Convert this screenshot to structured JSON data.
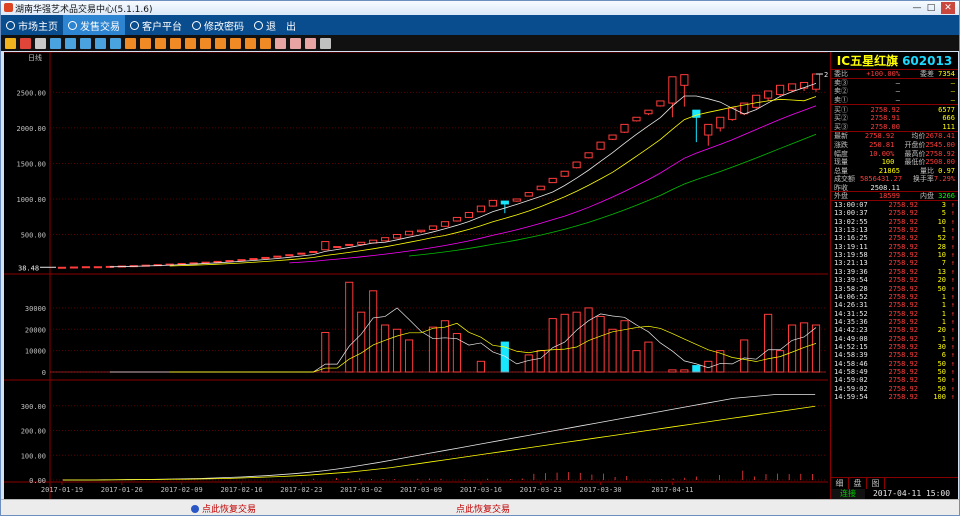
{
  "window": {
    "title": "湖南华强艺术品交易中心(5.1.1.6)",
    "min": "—",
    "max": "□",
    "close": "✕"
  },
  "menu": [
    {
      "label": "市场主页",
      "icon": "globe-icon",
      "active": false
    },
    {
      "label": "发售交易",
      "icon": "chart-icon",
      "active": true
    },
    {
      "label": "客户平台",
      "icon": "user-icon",
      "active": false
    },
    {
      "label": "修改密码",
      "icon": "key-icon",
      "active": false
    },
    {
      "label": "退",
      "icon": "power-icon",
      "active": false
    },
    {
      "label": "出",
      "icon": "",
      "active": false
    }
  ],
  "toolbar_colors": [
    "#f2b21e",
    "#e0453a",
    "#c9c9c9",
    "#4aa3df",
    "#4aa3df",
    "#4aa3df",
    "#4aa3df",
    "#4aa3df",
    "#f08a24",
    "#f08a24",
    "#f08a24",
    "#f08a24",
    "#f08a24",
    "#f08a24",
    "#f08a24",
    "#f08a24",
    "#f08a24",
    "#f08a24",
    "#e8a3a3",
    "#e8a3a3",
    "#e8a3a3",
    "#c0c0c0"
  ],
  "stock": {
    "name": "IC五星红旗",
    "code": "602013"
  },
  "quote": {
    "weibi_label": "委比",
    "weibi": "+100.00%",
    "weicha_label": "委差",
    "weicha": "7354",
    "sell": [
      {
        "label": "卖③",
        "price": "—",
        "vol": "—"
      },
      {
        "label": "卖②",
        "price": "—",
        "vol": "—"
      },
      {
        "label": "卖①",
        "price": "—",
        "vol": "—"
      }
    ],
    "buy": [
      {
        "label": "买①",
        "price": "2758.92",
        "vol": "6577"
      },
      {
        "label": "买②",
        "price": "2758.91",
        "vol": "666"
      },
      {
        "label": "买③",
        "price": "2758.00",
        "vol": "111"
      }
    ],
    "stats": [
      {
        "l1": "最新",
        "v1": "2758.92",
        "l2": "均价",
        "v2": "2678.41"
      },
      {
        "l1": "涨跌",
        "v1": "250.81",
        "l2": "开盘价",
        "v2": "2545.00"
      },
      {
        "l1": "幅度",
        "v1": "10.00%",
        "l2": "最高价",
        "v2": "2758.92"
      },
      {
        "l1": "现量",
        "v1": "100",
        "l2": "最低价",
        "v2": "2508.00"
      },
      {
        "l1": "总量",
        "v1": "21865",
        "l2": "量比",
        "v2": "0.97"
      },
      {
        "l1": "成交额",
        "v1": "5856431.27",
        "l2": "换手率",
        "v2": "7.29%"
      }
    ],
    "prev_label": "昨收",
    "prev": "2508.11",
    "outer_label": "外盘",
    "outer": "18599",
    "inner_label": "内盘",
    "inner": "3266"
  },
  "ticks": [
    {
      "t": "13:00:07",
      "p": "2758.92",
      "v": "3"
    },
    {
      "t": "13:00:37",
      "p": "2758.92",
      "v": "5"
    },
    {
      "t": "13:02:55",
      "p": "2758.92",
      "v": "10"
    },
    {
      "t": "13:13:13",
      "p": "2758.92",
      "v": "1"
    },
    {
      "t": "13:16:25",
      "p": "2758.92",
      "v": "52"
    },
    {
      "t": "13:19:11",
      "p": "2758.92",
      "v": "28"
    },
    {
      "t": "13:19:58",
      "p": "2758.92",
      "v": "10"
    },
    {
      "t": "13:21:13",
      "p": "2758.92",
      "v": "7"
    },
    {
      "t": "13:39:36",
      "p": "2758.92",
      "v": "13"
    },
    {
      "t": "13:39:54",
      "p": "2758.92",
      "v": "20"
    },
    {
      "t": "13:58:28",
      "p": "2758.92",
      "v": "50"
    },
    {
      "t": "14:06:52",
      "p": "2758.92",
      "v": "1"
    },
    {
      "t": "14:26:31",
      "p": "2758.92",
      "v": "1"
    },
    {
      "t": "14:31:52",
      "p": "2758.92",
      "v": "1"
    },
    {
      "t": "14:35:36",
      "p": "2758.92",
      "v": "1"
    },
    {
      "t": "14:42:23",
      "p": "2758.92",
      "v": "20"
    },
    {
      "t": "14:49:08",
      "p": "2758.92",
      "v": "1"
    },
    {
      "t": "14:52:15",
      "p": "2758.92",
      "v": "30"
    },
    {
      "t": "14:58:39",
      "p": "2758.92",
      "v": "6"
    },
    {
      "t": "14:58:46",
      "p": "2758.92",
      "v": "50"
    },
    {
      "t": "14:58:49",
      "p": "2758.92",
      "v": "50"
    },
    {
      "t": "14:59:02",
      "p": "2758.92",
      "v": "50"
    },
    {
      "t": "14:59:02",
      "p": "2758.92",
      "v": "50"
    },
    {
      "t": "14:59:54",
      "p": "2758.92",
      "v": "100"
    }
  ],
  "tick_arrow": "↑",
  "panel_tabs": [
    "细",
    "盘",
    "图"
  ],
  "status": {
    "conn": "连接",
    "datetime": "2017-04-11 15:00"
  },
  "bottom": {
    "left": "点此恢复交易",
    "right": "点此恢复交易"
  },
  "chart_data": {
    "type": "candlestick",
    "period_label": "日线",
    "price_ticks": [
      "2500.00",
      "2000.00",
      "1500.00",
      "1000.00",
      "500.00"
    ],
    "price_ylim": [
      0,
      2900
    ],
    "max_label": "2758.92",
    "min_label": "38.48",
    "volume_ticks": [
      "30000",
      "20000",
      "10000",
      "0"
    ],
    "volume_ylim": [
      0,
      44000
    ],
    "ind_ticks": [
      "300.00",
      "200.00",
      "100.00",
      "0.00"
    ],
    "ind_ylim": [
      0,
      380
    ],
    "x_labels": [
      "2017-01-19",
      "2017-01-26",
      "2017-02-09",
      "2017-02-16",
      "2017-02-23",
      "2017-03-02",
      "2017-03-09",
      "2017-03-16",
      "2017-03-23",
      "2017-03-30",
      "2017-04-11"
    ],
    "x_label_index": [
      0,
      5,
      10,
      15,
      20,
      25,
      30,
      35,
      40,
      45,
      51
    ],
    "candles": [
      [
        38.48,
        38.48,
        38.48,
        38.48
      ],
      [
        40,
        42,
        39,
        42
      ],
      [
        46,
        46,
        46,
        46
      ],
      [
        46,
        46,
        46,
        46
      ],
      [
        51,
        51,
        51,
        51
      ],
      [
        56,
        56,
        56,
        56
      ],
      [
        61,
        61,
        61,
        61
      ],
      [
        68,
        68,
        68,
        68
      ],
      [
        75,
        75,
        75,
        75
      ],
      [
        83,
        83,
        83,
        83
      ],
      [
        91,
        91,
        91,
        91
      ],
      [
        100,
        100,
        100,
        100
      ],
      [
        110,
        110,
        110,
        110
      ],
      [
        121,
        121,
        121,
        121
      ],
      [
        133,
        133,
        133,
        133
      ],
      [
        146,
        146,
        146,
        146
      ],
      [
        161,
        161,
        161,
        161
      ],
      [
        177,
        177,
        177,
        177
      ],
      [
        195,
        195,
        195,
        195
      ],
      [
        215,
        215,
        215,
        215
      ],
      [
        237,
        237,
        237,
        237
      ],
      [
        261,
        261,
        261,
        261
      ],
      [
        285,
        400,
        285,
        340
      ],
      [
        330,
        330,
        330,
        330
      ],
      [
        350,
        360,
        345,
        355
      ],
      [
        360,
        390,
        355,
        385
      ],
      [
        380,
        420,
        370,
        415
      ],
      [
        410,
        455,
        405,
        450
      ],
      [
        450,
        500,
        445,
        495
      ],
      [
        495,
        545,
        490,
        540
      ],
      [
        540,
        560,
        520,
        560
      ],
      [
        570,
        620,
        560,
        615
      ],
      [
        615,
        680,
        610,
        675
      ],
      [
        690,
        740,
        680,
        735
      ],
      [
        740,
        810,
        735,
        805
      ],
      [
        820,
        900,
        815,
        895
      ],
      [
        900,
        980,
        890,
        975
      ],
      [
        970,
        930,
        800,
        930
      ],
      [
        970,
        1000,
        960,
        995
      ],
      [
        1040,
        1090,
        1035,
        1085
      ],
      [
        1130,
        1180,
        1125,
        1175
      ],
      [
        1230,
        1290,
        1225,
        1285
      ],
      [
        1320,
        1390,
        1310,
        1385
      ],
      [
        1440,
        1520,
        1430,
        1515
      ],
      [
        1580,
        1650,
        1570,
        1645
      ],
      [
        1700,
        1800,
        1690,
        1795
      ],
      [
        1840,
        1900,
        1830,
        1895
      ],
      [
        1940,
        2050,
        1930,
        2045
      ],
      [
        2100,
        2150,
        2090,
        2145
      ],
      [
        2200,
        2250,
        2180,
        2240
      ],
      [
        2310,
        2380,
        2300,
        2375
      ],
      [
        2350,
        2720,
        2150,
        2450
      ],
      [
        2600,
        2750,
        2300,
        2350
      ],
      [
        2250,
        2150,
        1800,
        1900
      ],
      [
        1900,
        2050,
        1750,
        1980
      ],
      [
        2000,
        2150,
        1950,
        2130
      ],
      [
        2120,
        2280,
        2100,
        2260
      ],
      [
        2200,
        2350,
        2180,
        2320
      ],
      [
        2290,
        2460,
        2270,
        2440
      ],
      [
        2420,
        2520,
        2380,
        2500
      ],
      [
        2470,
        2600,
        2450,
        2580
      ],
      [
        2530,
        2620,
        2500,
        2600
      ],
      [
        2560,
        2640,
        2520,
        2580
      ],
      [
        2545,
        2758.92,
        2508,
        2758.92
      ]
    ],
    "volumes": [
      0,
      0,
      0,
      0,
      0,
      0,
      0,
      0,
      0,
      0,
      0,
      0,
      0,
      0,
      0,
      0,
      0,
      0,
      0,
      0,
      0,
      0,
      18500,
      0,
      42000,
      28000,
      38000,
      22000,
      20000,
      15000,
      0,
      21000,
      24000,
      18000,
      0,
      5000,
      0,
      14000,
      0,
      8000,
      10000,
      25000,
      27000,
      28000,
      30000,
      26000,
      20000,
      24000,
      10000,
      14000,
      0,
      1000,
      1000,
      3000,
      5000,
      10000,
      0,
      15000,
      0,
      27000,
      10000,
      22000,
      23000,
      22000,
      23000,
      22000
    ],
    "ind1": [
      0,
      0,
      0,
      1,
      1,
      2,
      2,
      3,
      4,
      5,
      6,
      8,
      10,
      12,
      15,
      18,
      22,
      26,
      31,
      37,
      44,
      52,
      61,
      70,
      80,
      90,
      100,
      110,
      120,
      130,
      140,
      150,
      160,
      170,
      180,
      190,
      200,
      210,
      220,
      230,
      240,
      250,
      260,
      270,
      280,
      290,
      300,
      310,
      320,
      330,
      335,
      340,
      345,
      345,
      345,
      345
    ],
    "ind2": [
      0,
      0,
      0,
      0,
      1,
      1,
      2,
      2,
      3,
      3,
      4,
      5,
      6,
      8,
      10,
      12,
      14,
      17,
      20,
      24,
      28,
      32,
      38,
      44,
      50,
      58,
      66,
      74,
      82,
      90,
      98,
      106,
      114,
      122,
      130,
      138,
      146,
      154,
      162,
      170,
      178,
      186,
      194,
      202,
      210,
      218,
      226,
      234,
      242,
      250,
      258,
      266,
      274,
      282,
      290,
      298
    ],
    "ind_bars": [
      0,
      0,
      0,
      0,
      0,
      0,
      0,
      0,
      0,
      0,
      0,
      0,
      0,
      0,
      0,
      0,
      0,
      0,
      0,
      0,
      0,
      0,
      5,
      0,
      8,
      6,
      7,
      4,
      4,
      3,
      0,
      5,
      6,
      5,
      0,
      3,
      0,
      5,
      0,
      4,
      6,
      25,
      28,
      30,
      32,
      29,
      22,
      26,
      12,
      16,
      0,
      2,
      3,
      6,
      9,
      14,
      0,
      20,
      0,
      38,
      14,
      24,
      26,
      24,
      25,
      24
    ]
  }
}
